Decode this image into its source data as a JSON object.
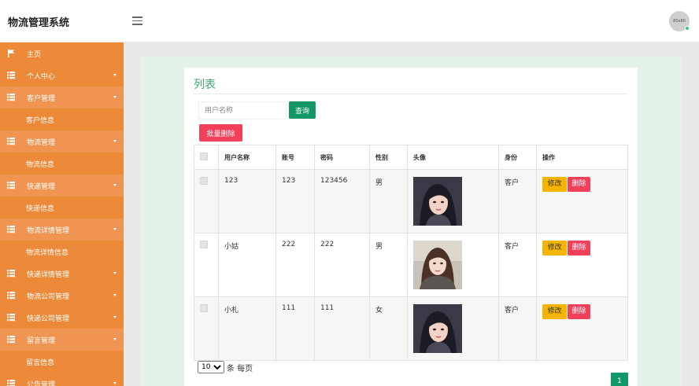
{
  "header": {
    "brand": "物流管理系统",
    "menu_icon": "hamburger-icon",
    "avatar_text": "80x80"
  },
  "sidebar": {
    "items": [
      {
        "label": "主页",
        "type": "top",
        "icon": "flag-icon"
      },
      {
        "label": "个人中心",
        "type": "top",
        "icon": "grid-icon",
        "caret": true
      },
      {
        "label": "客户管理",
        "type": "group",
        "icon": "grid-icon",
        "caret": true
      },
      {
        "label": "客户信息",
        "type": "sub"
      },
      {
        "label": "物流管理",
        "type": "group",
        "icon": "grid-icon",
        "caret": true
      },
      {
        "label": "物流信息",
        "type": "sub"
      },
      {
        "label": "快递管理",
        "type": "group",
        "icon": "grid-icon",
        "caret": true
      },
      {
        "label": "快递信息",
        "type": "sub"
      },
      {
        "label": "物流详情管理",
        "type": "group",
        "icon": "grid-icon",
        "caret": true
      },
      {
        "label": "物流详情信息",
        "type": "sub"
      },
      {
        "label": "快递详情管理",
        "type": "top",
        "icon": "grid-icon",
        "caret": true
      },
      {
        "label": "物流公司管理",
        "type": "top",
        "icon": "grid-icon",
        "caret": true
      },
      {
        "label": "快递公司管理",
        "type": "top",
        "icon": "grid-icon",
        "caret": true
      },
      {
        "label": "留言管理",
        "type": "group",
        "icon": "grid-icon",
        "caret": true
      },
      {
        "label": "留言信息",
        "type": "sub"
      },
      {
        "label": "公告管理",
        "type": "top",
        "icon": "grid-icon",
        "caret": true
      }
    ]
  },
  "main": {
    "title": "列表",
    "search": {
      "placeholder": "用户名称",
      "button": "查询"
    },
    "batch_delete": "批量删除",
    "table": {
      "headers": [
        "用户名称",
        "账号",
        "密码",
        "性别",
        "头像",
        "身份",
        "操作"
      ],
      "rows": [
        {
          "name": "123",
          "account": "123",
          "password": "123456",
          "gender": "男",
          "role": "客户",
          "photo": "portrait-girl-dark-hair"
        },
        {
          "name": "小姑",
          "account": "222",
          "password": "222",
          "gender": "男",
          "role": "客户",
          "photo": "portrait-girl-brown-hair"
        },
        {
          "name": "小札",
          "account": "111",
          "password": "111",
          "gender": "女",
          "role": "客户",
          "photo": "portrait-girl-dark-hair"
        }
      ],
      "edit_label": "修改",
      "delete_label": "删除"
    },
    "pager": {
      "page_size": "10",
      "per_page_text": "条 每页",
      "current_page": "1"
    }
  },
  "colors": {
    "sidebar": "#ed8a3a",
    "accent_green": "#139766",
    "danger": "#f2405a",
    "warning": "#f4b400"
  }
}
